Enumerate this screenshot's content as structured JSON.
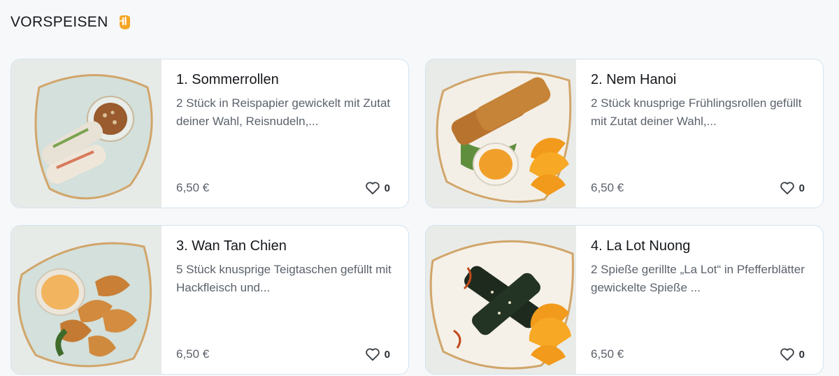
{
  "section": {
    "title": "VORSPEISEN",
    "icon": "hand-icon",
    "accent": "#f5a623"
  },
  "items": [
    {
      "name": "1. Sommerrollen",
      "description": "2 Stück in Reispapier gewickelt mit Zutat deiner Wahl, Reisnudeln,...",
      "price": "6,50 €",
      "likes": "0",
      "plate_color": "#d9e4e0"
    },
    {
      "name": "2. Nem Hanoi",
      "description": "2 Stück knusprige Frühlingsrollen gefüllt mit Zutat deiner Wahl,...",
      "price": "6,50 €",
      "likes": "0",
      "plate_color": "#f3efe6"
    },
    {
      "name": "3. Wan Tan Chien",
      "description": "5 Stück knusprige Teigtaschen gefüllt mit Hackfleisch und...",
      "price": "6,50 €",
      "likes": "0",
      "plate_color": "#d9e4e0"
    },
    {
      "name": "4. La Lot Nuong",
      "description": "2 Spieße gerillte „La Lot“ in Pfefferblätter gewickelte Spieße ...",
      "price": "6,50 €",
      "likes": "0",
      "plate_color": "#f3efe6"
    }
  ]
}
